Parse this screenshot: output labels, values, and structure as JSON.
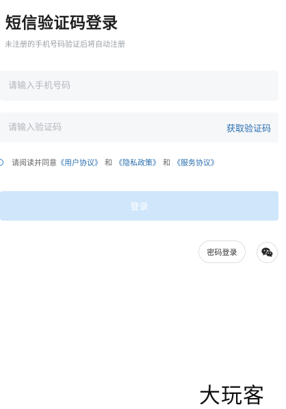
{
  "header": {
    "title": "短信验证码登录",
    "subtitle": "未注册的手机号码验证后将自动注册"
  },
  "form": {
    "phone_placeholder": "请输入手机号码",
    "phone_value": "",
    "code_placeholder": "请输入验证码",
    "code_value": "",
    "get_code_label": "获取验证码"
  },
  "agreement": {
    "checked": false,
    "prefix": "请阅读并同意",
    "user_agreement": "《用户协议》",
    "and1": "和",
    "privacy_policy": "《隐私政策》",
    "and2": "和",
    "service_agreement": "《服务协议》"
  },
  "login_button_label": "登录",
  "alt_login": {
    "password_login_label": "密码登录",
    "wechat_icon": "wechat-icon"
  },
  "watermark_text": "大玩客",
  "colors": {
    "link": "#2a6fb0",
    "login_button_bg": "#cfe6fb",
    "field_bg": "#f6f7f9",
    "radio": "#2f7fd0"
  }
}
